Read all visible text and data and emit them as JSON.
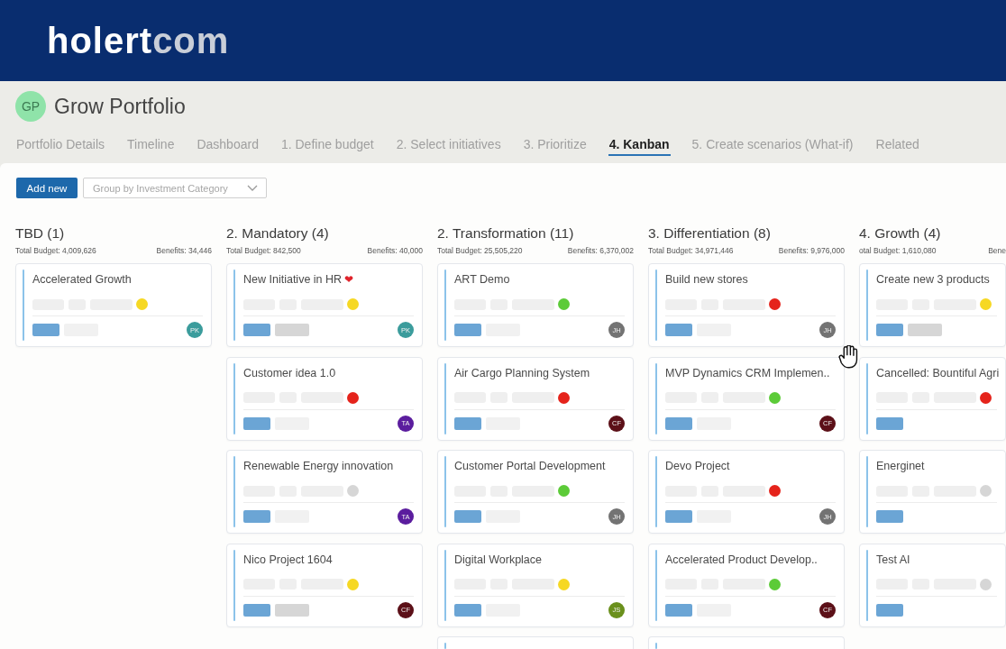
{
  "banner": {
    "logo": "holert",
    "logo_suffix": "com"
  },
  "portfolio": {
    "initials": "GP",
    "title": "Grow Portfolio"
  },
  "tabs": [
    {
      "label": "Portfolio Details",
      "selected": false
    },
    {
      "label": "Timeline",
      "selected": false
    },
    {
      "label": "Dashboard",
      "selected": false
    },
    {
      "label": "1. Define budget",
      "selected": false
    },
    {
      "label": "2. Select initiatives",
      "selected": false
    },
    {
      "label": "3. Prioritize",
      "selected": false
    },
    {
      "label": "4. Kanban",
      "selected": true
    },
    {
      "label": "5. Create scenarios (What-if)",
      "selected": false
    },
    {
      "label": "Related",
      "selected": false
    }
  ],
  "toolbar": {
    "add_button": "Add new",
    "group_by": {
      "placeholder": "Group by Investment Category"
    }
  },
  "columns": [
    {
      "title": "TBD (1)",
      "total_budget": "Total Budget: 4,009,626",
      "benefits": "Benefits: 34,446",
      "more_below": false,
      "cards": [
        {
          "title": "Accelerated Growth",
          "color": "#f6d823",
          "secondary_tag": true,
          "secondary_tag_dark": false,
          "avatar": {
            "initials": "PK",
            "color": "#3b9c9c"
          }
        }
      ]
    },
    {
      "title": "2. Mandatory (4)",
      "total_budget": "Total Budget: 842,500",
      "benefits": "Benefits: 40,000",
      "more_below": false,
      "cards": [
        {
          "title": "New Initiative in HR",
          "emoji": "❤",
          "color": "#f6d823",
          "secondary_tag": true,
          "secondary_tag_dark": true,
          "avatar": {
            "initials": "PK",
            "color": "#3b9c9c"
          }
        },
        {
          "title": "Customer idea 1.0",
          "color": "#e5231b",
          "secondary_tag": true,
          "secondary_tag_dark": false,
          "avatar": {
            "initials": "TA",
            "color": "#5b1d9e"
          }
        },
        {
          "title": "Renewable Energy innovation",
          "color": "#d6d6d6",
          "secondary_tag": true,
          "secondary_tag_dark": false,
          "avatar": {
            "initials": "TA",
            "color": "#5b1d9e"
          }
        },
        {
          "title": "Nico Project 1604",
          "color": "#f6d823",
          "secondary_tag": true,
          "secondary_tag_dark": true,
          "avatar": {
            "initials": "CF",
            "color": "#5c1018"
          }
        }
      ]
    },
    {
      "title": "2. Transformation (11)",
      "total_budget": "Total Budget: 25,505,220",
      "benefits": "Benefits: 6,370,002",
      "more_below": true,
      "cards": [
        {
          "title": "ART Demo",
          "color": "#5ccb38",
          "secondary_tag": true,
          "secondary_tag_dark": false,
          "avatar": {
            "initials": "JH",
            "color": "#737373"
          }
        },
        {
          "title": "Air Cargo Planning System",
          "color": "#e5231b",
          "secondary_tag": true,
          "secondary_tag_dark": false,
          "avatar": {
            "initials": "CF",
            "color": "#5c1018"
          }
        },
        {
          "title": "Customer Portal Development",
          "color": "#5ccb38",
          "secondary_tag": true,
          "secondary_tag_dark": false,
          "avatar": {
            "initials": "JH",
            "color": "#737373"
          }
        },
        {
          "title": "Digital Workplace",
          "color": "#f6d823",
          "secondary_tag": true,
          "secondary_tag_dark": false,
          "avatar": {
            "initials": "JS",
            "color": "#6a901c"
          }
        }
      ]
    },
    {
      "title": "3. Differentiation (8)",
      "total_budget": "Total Budget: 34,971,446",
      "benefits": "Benefits: 9,976,000",
      "more_below": true,
      "cards": [
        {
          "title": "Build new stores",
          "color": "#e5231b",
          "secondary_tag": true,
          "secondary_tag_dark": false,
          "avatar": {
            "initials": "JH",
            "color": "#737373"
          }
        },
        {
          "title": "MVP Dynamics CRM Implemen..",
          "color": "#5ccb38",
          "secondary_tag": true,
          "secondary_tag_dark": false,
          "avatar": {
            "initials": "CF",
            "color": "#5c1018"
          }
        },
        {
          "title": "Devo Project",
          "color": "#e5231b",
          "secondary_tag": true,
          "secondary_tag_dark": false,
          "avatar": {
            "initials": "JH",
            "color": "#737373"
          }
        },
        {
          "title": "Accelerated Product Develop..",
          "color": "#5ccb38",
          "secondary_tag": true,
          "secondary_tag_dark": false,
          "avatar": {
            "initials": "CF",
            "color": "#5c1018"
          }
        }
      ]
    },
    {
      "title": "4. Growth (4)",
      "total_budget": "otal Budget: 1,610,080",
      "benefits": "Bene",
      "more_below": false,
      "cards": [
        {
          "title": "Create new 3 products",
          "color": "#f6d823",
          "secondary_tag": true,
          "secondary_tag_dark": true
        },
        {
          "title": "Cancelled: Bountiful Agri",
          "color": "#e5231b",
          "secondary_tag": false
        },
        {
          "title": "Energinet",
          "color": "#d6d6d6",
          "secondary_tag": false
        },
        {
          "title": "Test AI",
          "color": "#d6d6d6",
          "secondary_tag": false
        }
      ]
    }
  ]
}
